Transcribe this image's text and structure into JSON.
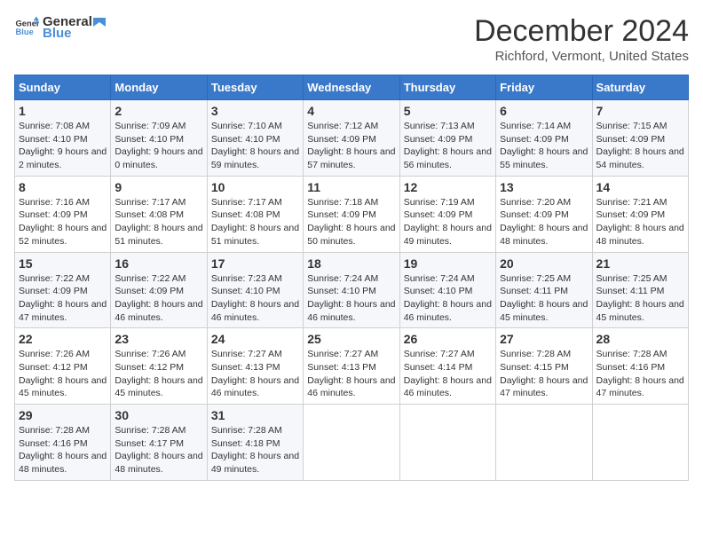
{
  "logo": {
    "general": "General",
    "blue": "Blue"
  },
  "title": "December 2024",
  "subtitle": "Richford, Vermont, United States",
  "days_of_week": [
    "Sunday",
    "Monday",
    "Tuesday",
    "Wednesday",
    "Thursday",
    "Friday",
    "Saturday"
  ],
  "weeks": [
    [
      {
        "day": "1",
        "sunrise": "7:08 AM",
        "sunset": "4:10 PM",
        "daylight": "9 hours and 2 minutes."
      },
      {
        "day": "2",
        "sunrise": "7:09 AM",
        "sunset": "4:10 PM",
        "daylight": "9 hours and 0 minutes."
      },
      {
        "day": "3",
        "sunrise": "7:10 AM",
        "sunset": "4:10 PM",
        "daylight": "8 hours and 59 minutes."
      },
      {
        "day": "4",
        "sunrise": "7:12 AM",
        "sunset": "4:09 PM",
        "daylight": "8 hours and 57 minutes."
      },
      {
        "day": "5",
        "sunrise": "7:13 AM",
        "sunset": "4:09 PM",
        "daylight": "8 hours and 56 minutes."
      },
      {
        "day": "6",
        "sunrise": "7:14 AM",
        "sunset": "4:09 PM",
        "daylight": "8 hours and 55 minutes."
      },
      {
        "day": "7",
        "sunrise": "7:15 AM",
        "sunset": "4:09 PM",
        "daylight": "8 hours and 54 minutes."
      }
    ],
    [
      {
        "day": "8",
        "sunrise": "7:16 AM",
        "sunset": "4:09 PM",
        "daylight": "8 hours and 52 minutes."
      },
      {
        "day": "9",
        "sunrise": "7:17 AM",
        "sunset": "4:08 PM",
        "daylight": "8 hours and 51 minutes."
      },
      {
        "day": "10",
        "sunrise": "7:17 AM",
        "sunset": "4:08 PM",
        "daylight": "8 hours and 51 minutes."
      },
      {
        "day": "11",
        "sunrise": "7:18 AM",
        "sunset": "4:09 PM",
        "daylight": "8 hours and 50 minutes."
      },
      {
        "day": "12",
        "sunrise": "7:19 AM",
        "sunset": "4:09 PM",
        "daylight": "8 hours and 49 minutes."
      },
      {
        "day": "13",
        "sunrise": "7:20 AM",
        "sunset": "4:09 PM",
        "daylight": "8 hours and 48 minutes."
      },
      {
        "day": "14",
        "sunrise": "7:21 AM",
        "sunset": "4:09 PM",
        "daylight": "8 hours and 48 minutes."
      }
    ],
    [
      {
        "day": "15",
        "sunrise": "7:22 AM",
        "sunset": "4:09 PM",
        "daylight": "8 hours and 47 minutes."
      },
      {
        "day": "16",
        "sunrise": "7:22 AM",
        "sunset": "4:09 PM",
        "daylight": "8 hours and 46 minutes."
      },
      {
        "day": "17",
        "sunrise": "7:23 AM",
        "sunset": "4:10 PM",
        "daylight": "8 hours and 46 minutes."
      },
      {
        "day": "18",
        "sunrise": "7:24 AM",
        "sunset": "4:10 PM",
        "daylight": "8 hours and 46 minutes."
      },
      {
        "day": "19",
        "sunrise": "7:24 AM",
        "sunset": "4:10 PM",
        "daylight": "8 hours and 46 minutes."
      },
      {
        "day": "20",
        "sunrise": "7:25 AM",
        "sunset": "4:11 PM",
        "daylight": "8 hours and 45 minutes."
      },
      {
        "day": "21",
        "sunrise": "7:25 AM",
        "sunset": "4:11 PM",
        "daylight": "8 hours and 45 minutes."
      }
    ],
    [
      {
        "day": "22",
        "sunrise": "7:26 AM",
        "sunset": "4:12 PM",
        "daylight": "8 hours and 45 minutes."
      },
      {
        "day": "23",
        "sunrise": "7:26 AM",
        "sunset": "4:12 PM",
        "daylight": "8 hours and 45 minutes."
      },
      {
        "day": "24",
        "sunrise": "7:27 AM",
        "sunset": "4:13 PM",
        "daylight": "8 hours and 46 minutes."
      },
      {
        "day": "25",
        "sunrise": "7:27 AM",
        "sunset": "4:13 PM",
        "daylight": "8 hours and 46 minutes."
      },
      {
        "day": "26",
        "sunrise": "7:27 AM",
        "sunset": "4:14 PM",
        "daylight": "8 hours and 46 minutes."
      },
      {
        "day": "27",
        "sunrise": "7:28 AM",
        "sunset": "4:15 PM",
        "daylight": "8 hours and 47 minutes."
      },
      {
        "day": "28",
        "sunrise": "7:28 AM",
        "sunset": "4:16 PM",
        "daylight": "8 hours and 47 minutes."
      }
    ],
    [
      {
        "day": "29",
        "sunrise": "7:28 AM",
        "sunset": "4:16 PM",
        "daylight": "8 hours and 48 minutes."
      },
      {
        "day": "30",
        "sunrise": "7:28 AM",
        "sunset": "4:17 PM",
        "daylight": "8 hours and 48 minutes."
      },
      {
        "day": "31",
        "sunrise": "7:28 AM",
        "sunset": "4:18 PM",
        "daylight": "8 hours and 49 minutes."
      },
      null,
      null,
      null,
      null
    ]
  ]
}
